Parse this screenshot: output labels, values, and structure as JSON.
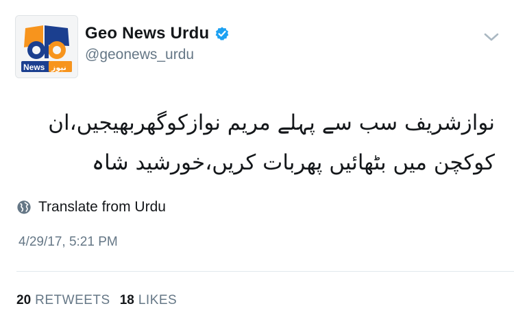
{
  "author": {
    "display_name": "Geo News Urdu",
    "handle": "@geonews_urdu",
    "verified_icon": "verified-badge-icon",
    "avatar": {
      "logo_text_en": "News",
      "logo_text_ur": "نیوز",
      "logo_mark": "geo"
    }
  },
  "menu_icon": "chevron-down-icon",
  "tweet": {
    "lines": [
      "نوازشریف سب سے پہلے مریم نوازکوگھربھیجیں،ان",
      "کوکچن میں بٹھائیں پھربات کریں،خورشید شاہ"
    ]
  },
  "translate": {
    "icon": "globe-icon",
    "label": "Translate from Urdu"
  },
  "timestamp": "4/29/17, 5:21 PM",
  "stats": {
    "retweets_count": "20",
    "retweets_label": "RETWEETS",
    "likes_count": "18",
    "likes_label": "LIKES"
  },
  "colors": {
    "text": "#14171a",
    "secondary": "#657786",
    "verified": "#1da1f2",
    "divider": "#e1e8ed",
    "logo_orange": "#f7941d",
    "logo_blue": "#1b3f8f"
  }
}
